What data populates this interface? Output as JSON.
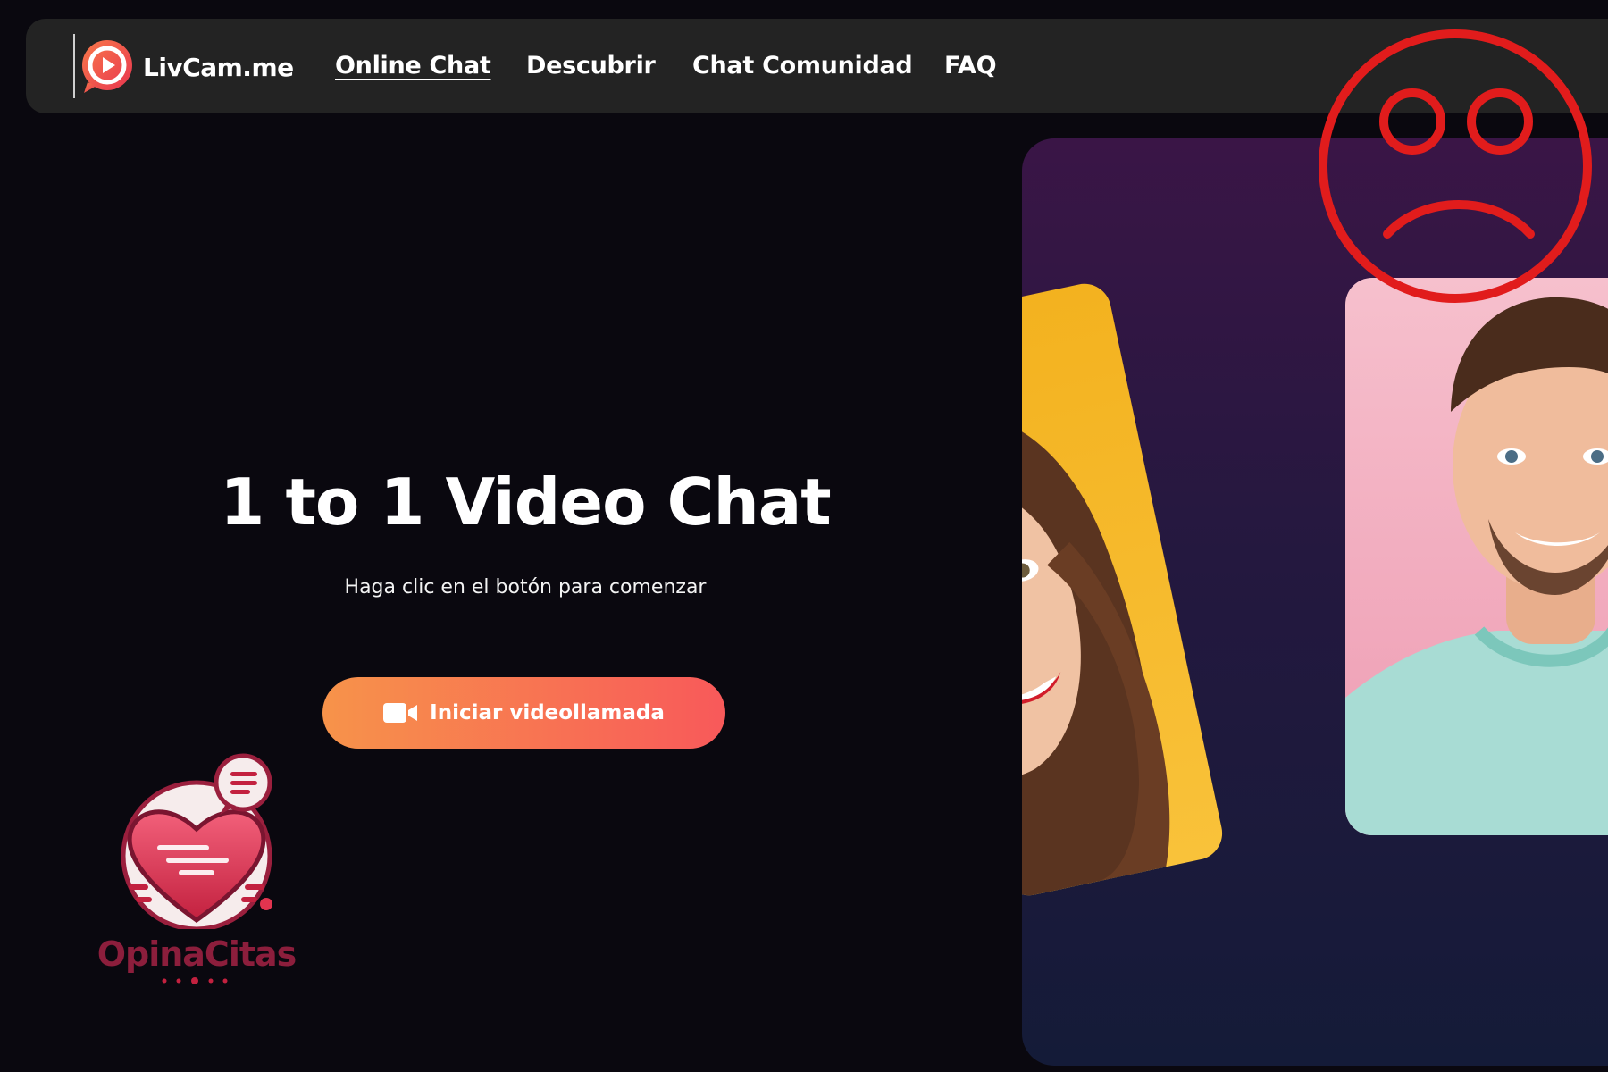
{
  "header": {
    "brand_name": "LivCam.me",
    "nav": [
      {
        "label": "Online Chat",
        "active": true
      },
      {
        "label": "Descubrir",
        "active": false
      },
      {
        "label": "Chat Comunidad",
        "active": false
      },
      {
        "label": "FAQ",
        "active": false
      }
    ]
  },
  "hero": {
    "title": "1 to 1 Video Chat",
    "subtitle": "Haga clic en el botón para comenzar",
    "cta_label": "Iniciar videollamada",
    "cta_icon": "video-camera-icon"
  },
  "watermark": {
    "text": "OpinaCitas",
    "icon": "heart-chat-icon"
  },
  "overlay": {
    "icon": "sad-face-icon",
    "color": "#e11c1c"
  },
  "colors": {
    "background": "#0a080f",
    "navbar": "#232323",
    "cta_gradient_start": "#f7934a",
    "cta_gradient_end": "#f8595a"
  }
}
